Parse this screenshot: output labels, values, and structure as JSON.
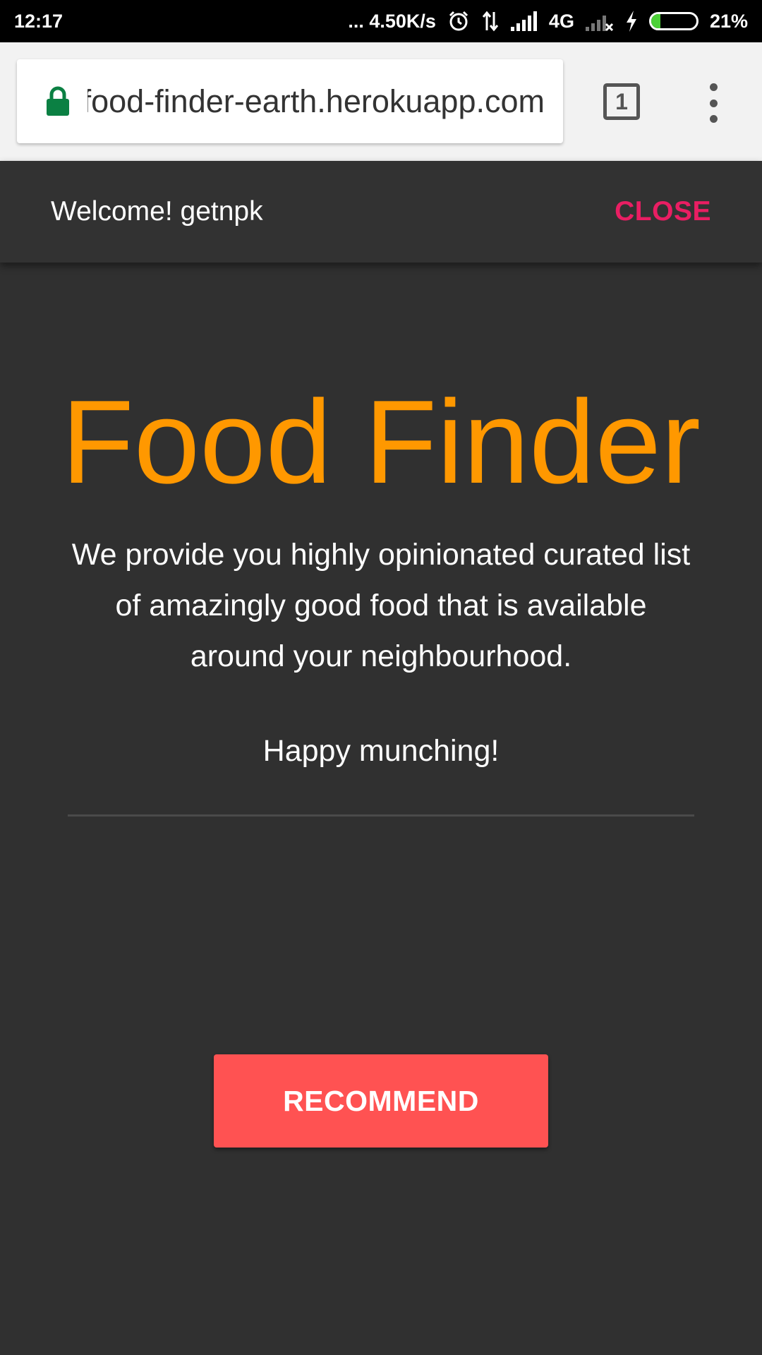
{
  "status_bar": {
    "time": "12:17",
    "network_speed": "... 4.50K/s",
    "network_type": "4G",
    "battery_percent": "21%",
    "battery_level": 0.21,
    "icons": [
      "alarm-icon",
      "data-transfer-icon",
      "signal-icon",
      "no-signal-icon",
      "charging-icon",
      "battery-icon"
    ]
  },
  "browser": {
    "url": "food-finder-earth.herokuapp.com",
    "tab_count": "1",
    "icons": [
      "lock-icon",
      "tabs-icon",
      "more-menu-icon"
    ],
    "lock_color": "#0b8043"
  },
  "banner": {
    "welcome_text": "Welcome! getnpk",
    "close_label": "CLOSE",
    "close_color": "#e91e63"
  },
  "main": {
    "title": "Food Finder",
    "title_color": "#ff9800",
    "description": "We provide you highly opinionated curated list of amazingly good food that is available around your neighbourhood.",
    "tagline": "Happy munching!",
    "recommend_label": "RECOMMEND",
    "recommend_color": "#ff5252"
  }
}
